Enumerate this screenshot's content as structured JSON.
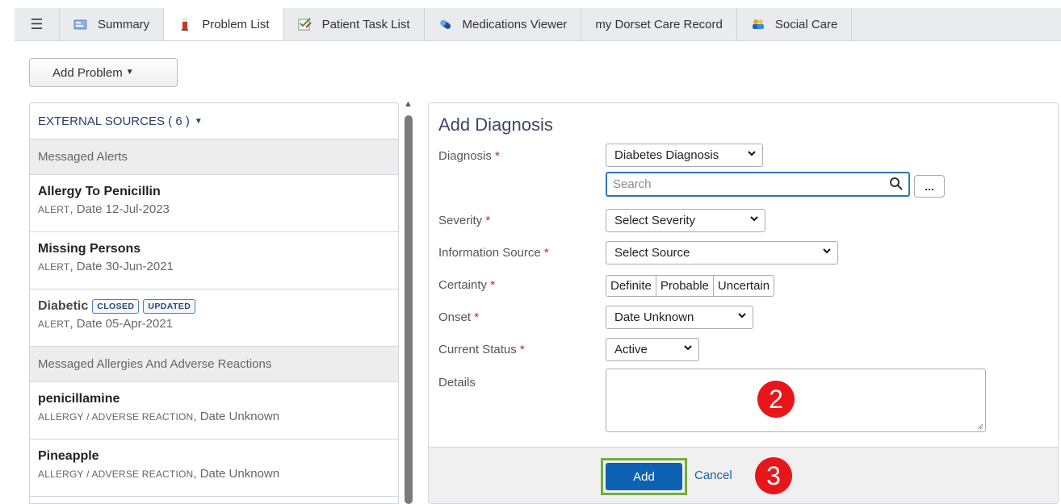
{
  "tabs": [
    {
      "label": "Summary",
      "icon": "summary-icon"
    },
    {
      "label": "Problem List",
      "icon": "problem-list-icon"
    },
    {
      "label": "Patient Task List",
      "icon": "task-list-icon"
    },
    {
      "label": "Medications Viewer",
      "icon": "pill-icon"
    },
    {
      "label": "my Dorset Care Record",
      "icon": ""
    },
    {
      "label": "Social Care",
      "icon": "people-icon"
    }
  ],
  "active_tab": "Problem List",
  "add_problem_label": "Add Problem",
  "left": {
    "external_sources_label": "EXTERNAL SOURCES",
    "external_sources_count": "( 6 )",
    "groups": [
      {
        "title": "Messaged Alerts",
        "items": [
          {
            "title": "Allergy To Penicillin",
            "type": "ALERT",
            "date": ", Date 12-Jul-2023"
          },
          {
            "title": "Missing Persons",
            "type": "ALERT",
            "date": ", Date 30-Jun-2021"
          },
          {
            "title": "Diabetic",
            "type": "ALERT",
            "date": ", Date 05-Apr-2021",
            "badges": [
              "CLOSED",
              "UPDATED"
            ]
          }
        ]
      },
      {
        "title": "Messaged Allergies And Adverse Reactions",
        "items": [
          {
            "title": "penicillamine",
            "type": "ALLERGY / ADVERSE REACTION",
            "date": ", Date Unknown"
          },
          {
            "title": "Pineapple",
            "type": "ALLERGY / ADVERSE REACTION",
            "date": ", Date Unknown"
          }
        ]
      }
    ]
  },
  "form": {
    "title": "Add Diagnosis",
    "required_mark": "*",
    "diagnosis_label": "Diagnosis",
    "diagnosis_value": "Diabetes Diagnosis",
    "search_placeholder": "Search",
    "more_button": "...",
    "severity_label": "Severity",
    "severity_value": "Select Severity",
    "source_label": "Information Source",
    "source_value": "Select Source",
    "certainty_label": "Certainty",
    "certainty_options": [
      "Definite",
      "Probable",
      "Uncertain"
    ],
    "onset_label": "Onset",
    "onset_value": "Date Unknown",
    "status_label": "Current Status",
    "status_value": "Active",
    "details_label": "Details",
    "details_value": "",
    "add_button": "Add",
    "cancel_link": "Cancel"
  },
  "markers": [
    "2",
    "3"
  ],
  "colors": {
    "primary_button": "#0d62b3",
    "marker": "#e8161b",
    "highlight_outline": "#6fb03c",
    "required": "#b52a2a"
  }
}
